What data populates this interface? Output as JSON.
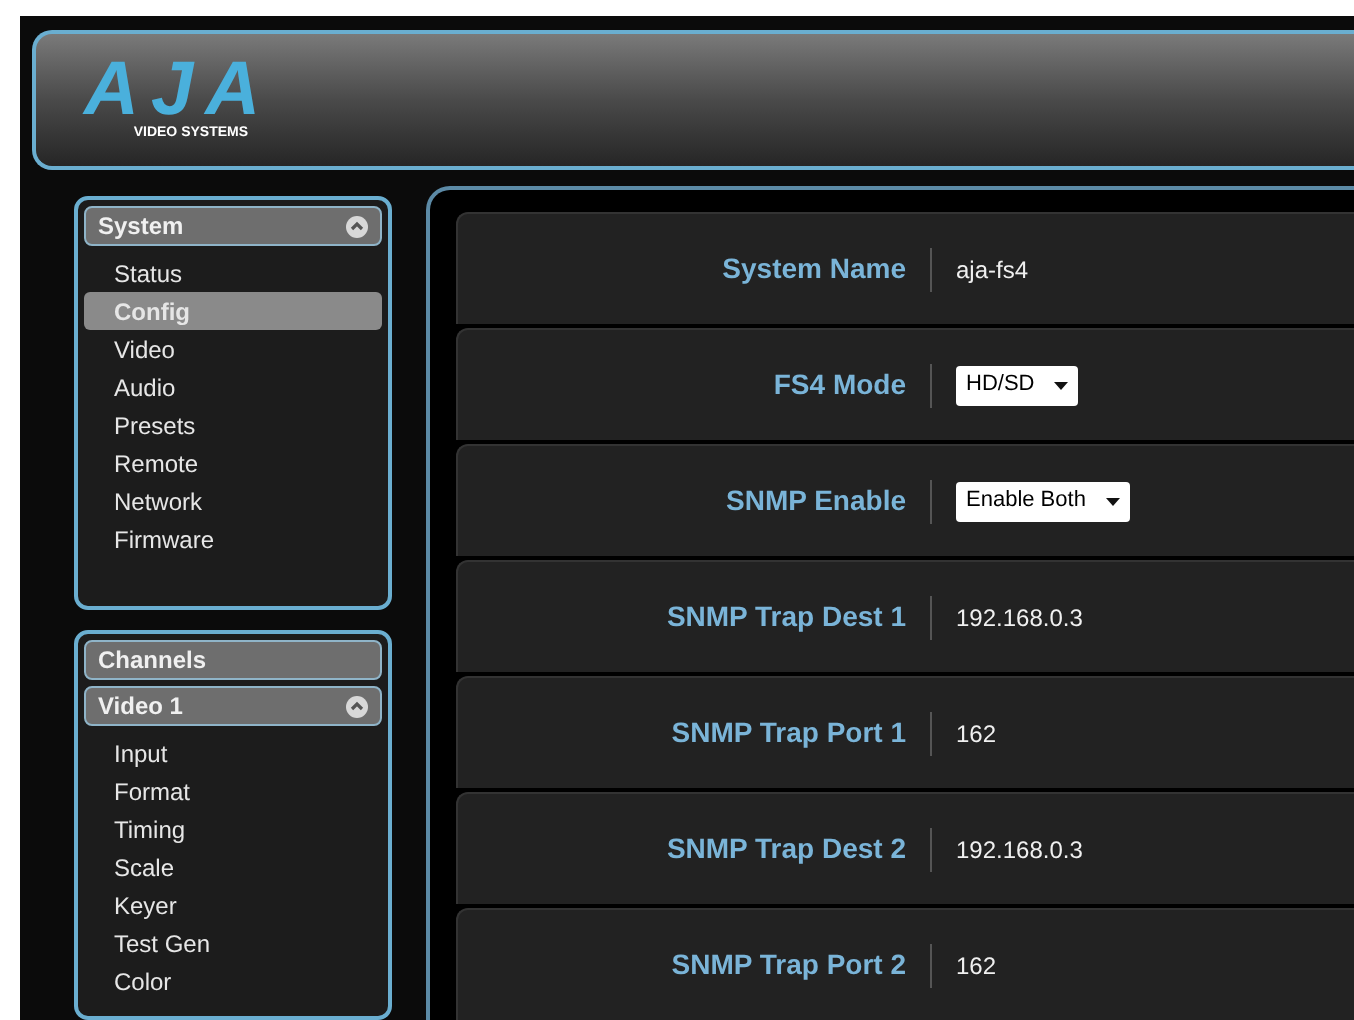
{
  "header": {
    "logo": "AJA",
    "logo_subtitle": "VIDEO SYSTEMS"
  },
  "sidebar": {
    "panels": [
      {
        "sections": [
          {
            "kind": "group",
            "title": "System",
            "expanded": true,
            "items": [
              {
                "label": "Status",
                "selected": false
              },
              {
                "label": "Config",
                "selected": true
              },
              {
                "label": "Video",
                "selected": false
              },
              {
                "label": "Audio",
                "selected": false
              },
              {
                "label": "Presets",
                "selected": false
              },
              {
                "label": "Remote",
                "selected": false
              },
              {
                "label": "Network",
                "selected": false
              },
              {
                "label": "Firmware",
                "selected": false
              }
            ]
          }
        ]
      },
      {
        "sections": [
          {
            "kind": "heading",
            "title": "Channels"
          },
          {
            "kind": "group",
            "title": "Video 1",
            "expanded": true,
            "items": [
              {
                "label": "Input",
                "selected": false
              },
              {
                "label": "Format",
                "selected": false
              },
              {
                "label": "Timing",
                "selected": false
              },
              {
                "label": "Scale",
                "selected": false
              },
              {
                "label": "Keyer",
                "selected": false
              },
              {
                "label": "Test Gen",
                "selected": false
              },
              {
                "label": "Color",
                "selected": false
              }
            ]
          }
        ]
      }
    ]
  },
  "fields": [
    {
      "label": "System Name",
      "kind": "text",
      "value": "aja-fs4"
    },
    {
      "label": "FS4 Mode",
      "kind": "dropdown",
      "value": "HD/SD"
    },
    {
      "label": "SNMP Enable",
      "kind": "dropdown",
      "value": "Enable Both"
    },
    {
      "label": "SNMP Trap Dest 1",
      "kind": "text",
      "value": "192.168.0.3"
    },
    {
      "label": "SNMP Trap Port 1",
      "kind": "text",
      "value": "162"
    },
    {
      "label": "SNMP Trap Dest 2",
      "kind": "text",
      "value": "192.168.0.3"
    },
    {
      "label": "SNMP Trap Port 2",
      "kind": "text",
      "value": "162"
    }
  ]
}
